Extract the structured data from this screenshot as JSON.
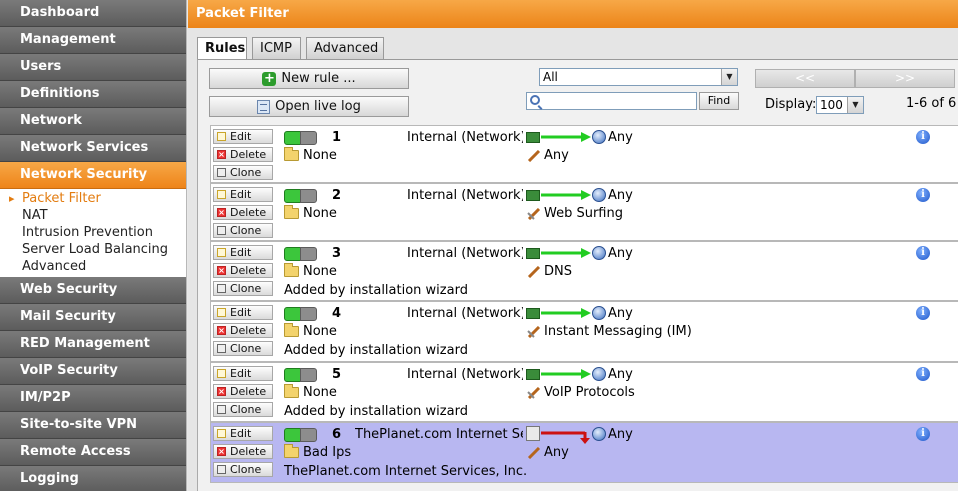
{
  "sidebar": {
    "items_top": [
      {
        "label": "Dashboard"
      },
      {
        "label": "Management"
      },
      {
        "label": "Users"
      },
      {
        "label": "Definitions"
      },
      {
        "label": "Network"
      },
      {
        "label": "Network Services"
      }
    ],
    "active_item": {
      "label": "Network Security"
    },
    "submenu": [
      {
        "label": "Packet Filter"
      },
      {
        "label": "NAT"
      },
      {
        "label": "Intrusion Prevention"
      },
      {
        "label": "Server Load Balancing"
      },
      {
        "label": "Advanced"
      }
    ],
    "items_bottom": [
      {
        "label": "Web Security"
      },
      {
        "label": "Mail Security"
      },
      {
        "label": "RED Management"
      },
      {
        "label": "VoIP Security"
      },
      {
        "label": "IM/P2P"
      },
      {
        "label": "Site-to-site VPN"
      },
      {
        "label": "Remote Access"
      },
      {
        "label": "Logging"
      }
    ]
  },
  "header": {
    "title": "Packet Filter"
  },
  "tabs": [
    {
      "label": "Rules"
    },
    {
      "label": "ICMP"
    },
    {
      "label": "Advanced"
    }
  ],
  "toolbar": {
    "new_rule_label": "New rule ...",
    "open_live_log_label": "Open live log",
    "filter_select_value": "All",
    "find_label": "Find",
    "search_value": "",
    "pager_prev_label": "<<",
    "pager_next_label": ">>",
    "display_label": "Display:",
    "display_value": "100",
    "range_text": "1-6 of 6"
  },
  "rule_actions": {
    "edit": "Edit",
    "delete": "Delete",
    "clone": "Clone"
  },
  "rules": [
    {
      "number": "1",
      "source": "Internal (Network)",
      "destination": "Any",
      "group": "None",
      "service": "Any",
      "comment": ""
    },
    {
      "number": "2",
      "source": "Internal (Network)",
      "destination": "Any",
      "group": "None",
      "service": "Web Surfing",
      "comment": ""
    },
    {
      "number": "3",
      "source": "Internal (Network)",
      "destination": "Any",
      "group": "None",
      "service": "DNS",
      "comment": "Added by installation wizard"
    },
    {
      "number": "4",
      "source": "Internal (Network)",
      "destination": "Any",
      "group": "None",
      "service": "Instant Messaging (IM)",
      "comment": "Added by installation wizard"
    },
    {
      "number": "5",
      "source": "Internal (Network)",
      "destination": "Any",
      "group": "None",
      "service": "VoIP Protocols",
      "comment": "Added by installation wizard"
    },
    {
      "number": "6",
      "source": "ThePlanet.com Internet Se",
      "destination": "Any",
      "group": "Bad Ips",
      "service": "Any",
      "comment": "ThePlanet.com Internet Services, Inc."
    }
  ],
  "colors": {
    "accent_orange": "#ee8419",
    "highlight_row": "#b8b7f1",
    "allow_arrow": "#22cc22",
    "deny_arrow": "#cc1111"
  }
}
